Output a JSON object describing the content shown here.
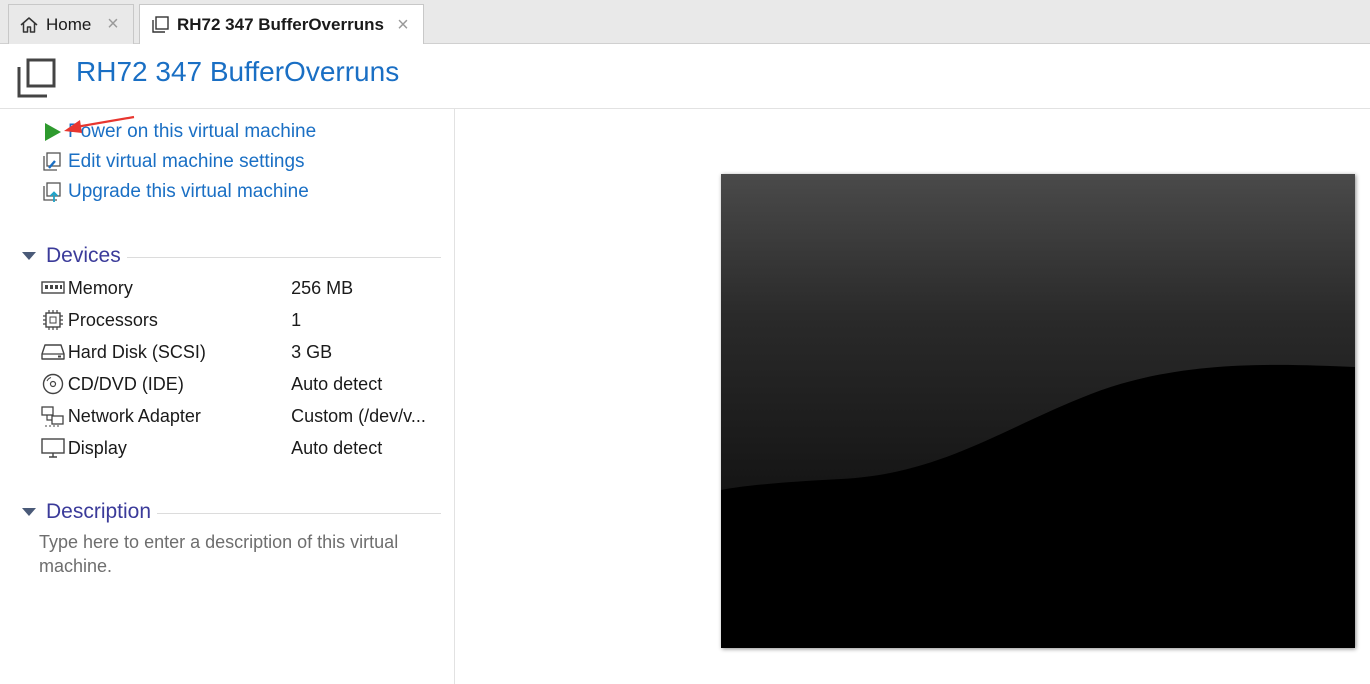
{
  "tabs": [
    {
      "label": "Home",
      "icon": "home-icon"
    },
    {
      "label": "RH72 347 BufferOverruns",
      "icon": "vm-icon"
    }
  ],
  "header": {
    "title": "RH72 347 BufferOverruns"
  },
  "actions": [
    {
      "label": "Power on this virtual machine",
      "icon": "play-icon",
      "color": "#2e9a2e"
    },
    {
      "label": "Edit virtual machine settings",
      "icon": "edit-settings-icon"
    },
    {
      "label": "Upgrade this virtual machine",
      "icon": "upgrade-icon"
    }
  ],
  "devices": {
    "heading": "Devices",
    "items": [
      {
        "name": "Memory",
        "value": "256 MB",
        "icon": "memory-icon"
      },
      {
        "name": "Processors",
        "value": "1",
        "icon": "processor-icon"
      },
      {
        "name": "Hard Disk (SCSI)",
        "value": "3 GB",
        "icon": "hard-disk-icon"
      },
      {
        "name": "CD/DVD (IDE)",
        "value": "Auto detect",
        "icon": "cd-dvd-icon"
      },
      {
        "name": "Network Adapter",
        "value": "Custom (/dev/v...",
        "icon": "network-adapter-icon"
      },
      {
        "name": "Display",
        "value": "Auto detect",
        "icon": "display-icon"
      }
    ]
  },
  "description": {
    "heading": "Description",
    "placeholder": "Type here to enter a description of this virtual machine."
  },
  "colors": {
    "accent": "#1a6fc4",
    "section_heading": "#3b3b9a",
    "annotation_arrow": "#e8362f"
  }
}
